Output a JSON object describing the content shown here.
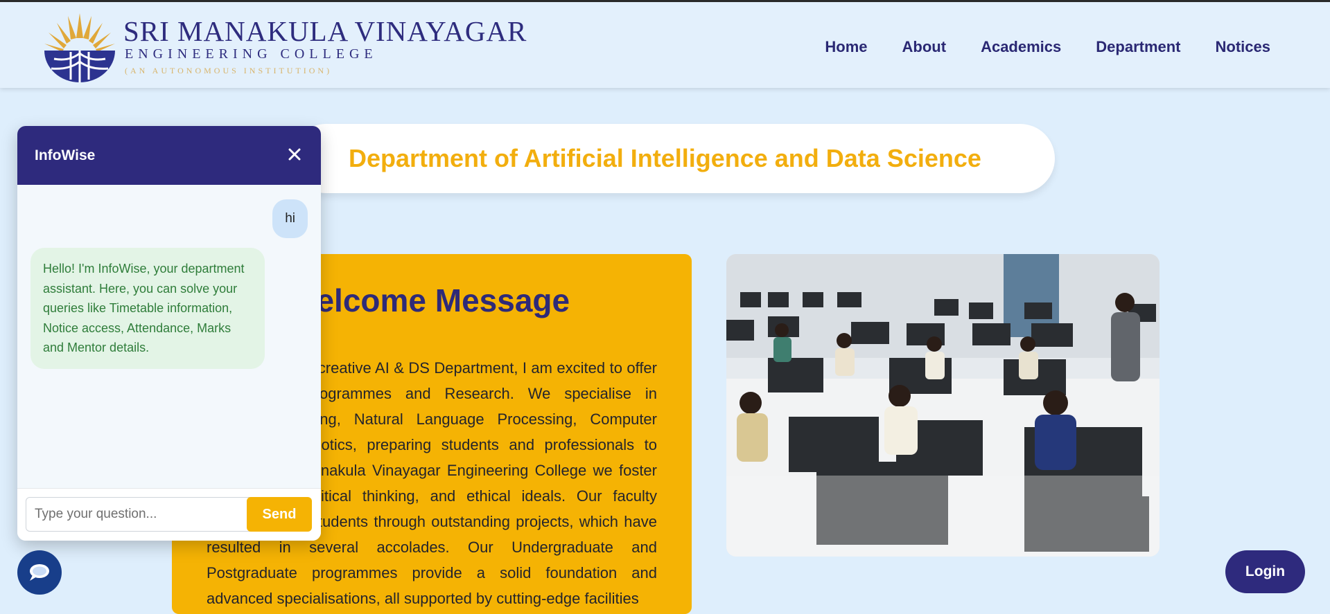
{
  "header": {
    "college_name": "SRI MANAKULA VINAYAGAR",
    "college_subtitle": "ENGINEERING COLLEGE",
    "college_tagline": "(AN AUTONOMOUS INSTITUTION)",
    "nav": [
      "Home",
      "About",
      "Academics",
      "Department",
      "Notices"
    ]
  },
  "banner": {
    "title": "Department of Artificial Intelligence and Data Science"
  },
  "welcome": {
    "heading": "Welcome Message",
    "body": "Welcome to our creative AI & DS Department, I am excited to offer cutting-edge Programmes and Research. We specialise in Machine Learning, Natural Language Processing, Computer Vision and Robotics, preparing students and professionals to thrive. At Sri Manakula Vinayagar Engineering College we foster collaboration, critical thinking, and ethical ideals. Our faculty members help students through outstanding projects, which have resulted in several accolades. Our Undergraduate and Postgraduate programmes provide a solid foundation and advanced specialisations, all supported by cutting-edge facilities"
  },
  "chat": {
    "title": "InfoWise",
    "messages": {
      "user": "hi",
      "bot": "Hello! I'm InfoWise, your department assistant. Here, you can solve your queries like Timetable information, Notice access, Attendance, Marks and Mentor details."
    },
    "input_placeholder": "Type your question...",
    "send_label": "Send"
  },
  "login_label": "Login",
  "colors": {
    "primary": "#2e2a7d",
    "accent": "#f5b304",
    "page_bg": "#deeefc",
    "bot_text": "#2f7d3a"
  },
  "icons": {
    "close": "close-icon",
    "chat_toggle": "chat-bubble-icon"
  }
}
